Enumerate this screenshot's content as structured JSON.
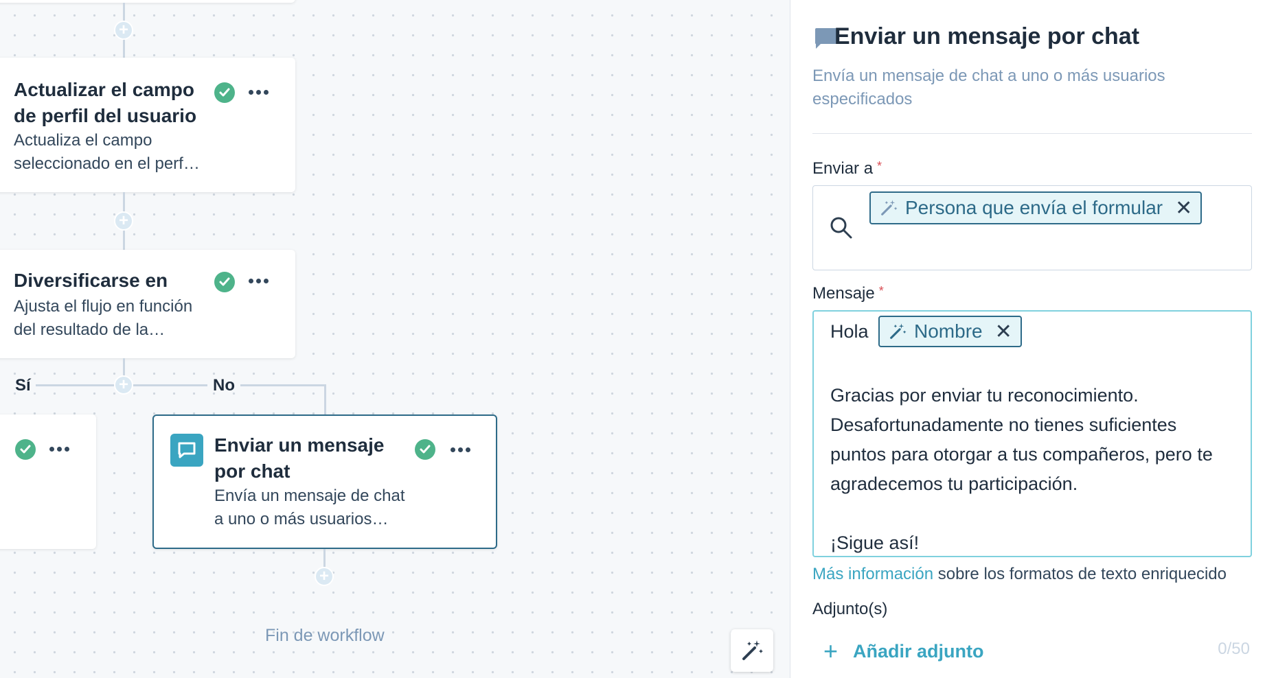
{
  "canvas": {
    "steps": [
      {
        "title_lines": [
          "Actualizar el campo",
          "de perfil del usuario"
        ],
        "desc_lines": [
          "Actualiza el campo",
          "seleccionado en el perf…"
        ],
        "accent": "#3aa5c1"
      },
      {
        "title_lines": [
          "Diversificarse en"
        ],
        "desc_lines": [
          "Ajusta el flujo en función",
          "del resultado de la…"
        ],
        "accent": "#f5c26b"
      },
      {
        "title_lines": [
          "Enviar un mensaje",
          "por chat"
        ],
        "desc_lines": [
          "Envía un mensaje de chat",
          "a uno o más usuarios…"
        ],
        "accent": "#2d6a88"
      }
    ],
    "branch_yes": "Sí",
    "branch_no": "No",
    "end_label": "Fin de workflow"
  },
  "panel": {
    "title": "Enviar un mensaje por chat",
    "description": "Envía un mensaje de chat a uno o más usuarios especificados",
    "send_to_label": "Enviar a",
    "send_to_token": "Persona que envía el formular",
    "message_label": "Mensaje",
    "message": {
      "greeting": "Hola",
      "name_token": "Nombre",
      "lines": [
        "Gracias por enviar tu reconocimiento.",
        "Desafortunadamente no tienes suficientes",
        "puntos para otorgar a tus compañeros, pero te",
        "agradecemos tu participación.",
        "¡Sigue así!"
      ]
    },
    "help_link": "Más información",
    "help_text": "sobre los formatos de texto enriquecido",
    "attachments_label": "Adjunto(s)",
    "add_attachment": "Añadir adjunto",
    "attachment_counter": "0/50"
  },
  "colors": {
    "success": "#4eb38a",
    "link": "#3aa5c1",
    "token_border": "#2d6a88",
    "required": "#d94c53"
  }
}
